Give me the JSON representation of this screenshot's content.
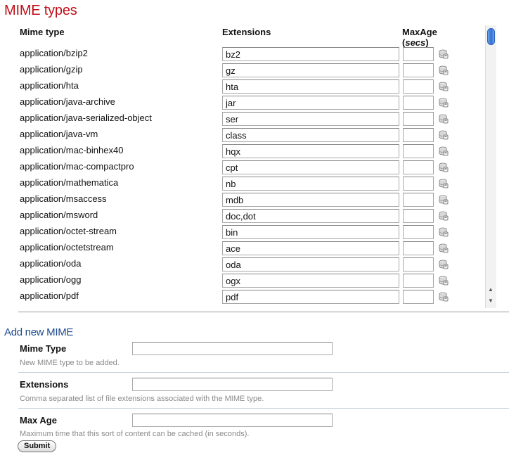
{
  "page_title": "MIME types",
  "table": {
    "headers": {
      "mime_type": "Mime type",
      "extensions": "Extensions",
      "max_age": "MaxAge",
      "max_age_unit": "secs"
    },
    "save_icon": "disk-save-icon",
    "rows": [
      {
        "mime": "application/bzip2",
        "ext": "bz2",
        "max_age": ""
      },
      {
        "mime": "application/gzip",
        "ext": "gz",
        "max_age": ""
      },
      {
        "mime": "application/hta",
        "ext": "hta",
        "max_age": ""
      },
      {
        "mime": "application/java-archive",
        "ext": "jar",
        "max_age": ""
      },
      {
        "mime": "application/java-serialized-object",
        "ext": "ser",
        "max_age": ""
      },
      {
        "mime": "application/java-vm",
        "ext": "class",
        "max_age": ""
      },
      {
        "mime": "application/mac-binhex40",
        "ext": "hqx",
        "max_age": ""
      },
      {
        "mime": "application/mac-compactpro",
        "ext": "cpt",
        "max_age": ""
      },
      {
        "mime": "application/mathematica",
        "ext": "nb",
        "max_age": ""
      },
      {
        "mime": "application/msaccess",
        "ext": "mdb",
        "max_age": ""
      },
      {
        "mime": "application/msword",
        "ext": "doc,dot",
        "max_age": ""
      },
      {
        "mime": "application/octet-stream",
        "ext": "bin",
        "max_age": ""
      },
      {
        "mime": "application/octetstream",
        "ext": "ace",
        "max_age": ""
      },
      {
        "mime": "application/oda",
        "ext": "oda",
        "max_age": ""
      },
      {
        "mime": "application/ogg",
        "ext": "ogx",
        "max_age": ""
      },
      {
        "mime": "application/pdf",
        "ext": "pdf",
        "max_age": ""
      }
    ]
  },
  "add_form": {
    "title": "Add new MIME",
    "mime_type": {
      "label": "Mime Type",
      "help": "New MIME type to be added.",
      "value": ""
    },
    "extensions": {
      "label": "Extensions",
      "help": "Comma separated list of file extensions associated with the MIME type.",
      "value": ""
    },
    "max_age": {
      "label": "Max Age",
      "help": "Maximum time that this sort of content can be cached (in seconds).",
      "value": ""
    },
    "submit_label": "Submit"
  },
  "colors": {
    "title": "#c0101a",
    "section_title": "#1e4a8e",
    "help_text": "#8a8a8a",
    "scroll_thumb": "#2f6fd6"
  }
}
